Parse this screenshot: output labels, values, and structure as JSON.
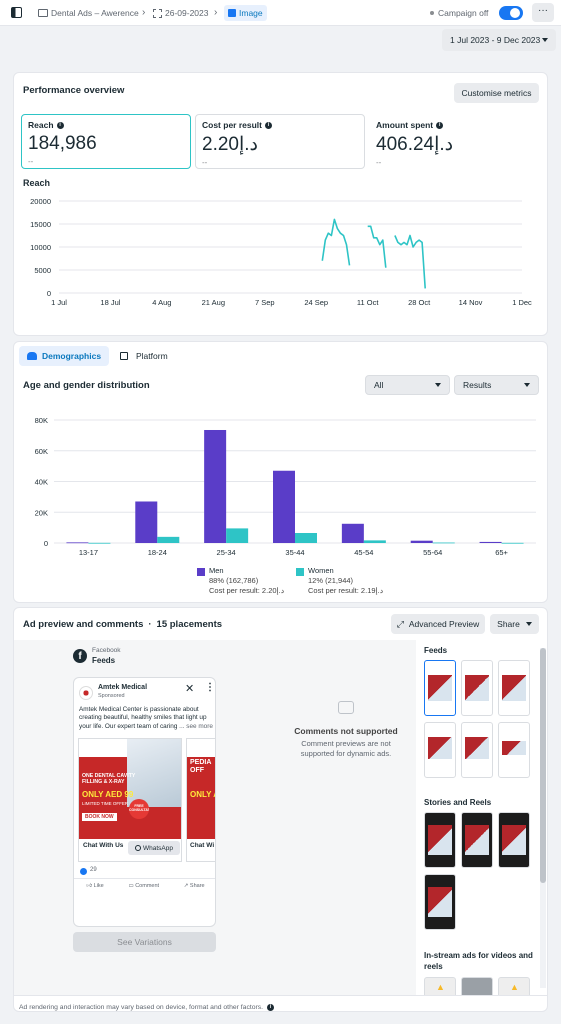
{
  "topbar": {
    "crumb1": "Dental Ads – Awerence",
    "crumb2": "26-09-2023",
    "crumb3": "Image",
    "campaign_status": "Campaign off"
  },
  "date_range": "1 Jul 2023 - 9 Dec 2023",
  "performance": {
    "title": "Performance overview",
    "customise_label": "Customise metrics",
    "metrics": [
      {
        "label": "Reach",
        "value": "184,986",
        "sub": "--"
      },
      {
        "label": "Cost per result",
        "value": "2.20د.إ",
        "sub": "--"
      },
      {
        "label": "Amount spent",
        "value": "406.24د.إ",
        "sub": "--"
      }
    ],
    "reach_chart_label": "Reach"
  },
  "chart_data": [
    {
      "type": "line",
      "title": "Reach",
      "x_ticks": [
        "1 Jul",
        "18 Jul",
        "4 Aug",
        "21 Aug",
        "7 Sep",
        "24 Sep",
        "11 Oct",
        "28 Oct",
        "14 Nov",
        "1 Dec"
      ],
      "y_ticks": [
        "0",
        "5000",
        "10000",
        "15000",
        "20000"
      ],
      "ylim": [
        0,
        20000
      ],
      "series": [
        {
          "x": [
            "2023-09-26",
            "2023-09-27",
            "2023-09-28",
            "2023-09-29",
            "2023-09-30",
            "2023-10-01",
            "2023-10-02",
            "2023-10-03",
            "2023-10-04",
            "2023-10-05"
          ],
          "values": [
            7000,
            11500,
            13000,
            12500,
            16000,
            14000,
            13000,
            12500,
            10500,
            6000
          ]
        },
        {
          "x": [
            "2023-10-11",
            "2023-10-12",
            "2023-10-13",
            "2023-10-14",
            "2023-10-15",
            "2023-10-16",
            "2023-10-17"
          ],
          "values": [
            14500,
            14500,
            12000,
            12000,
            10500,
            11500,
            5500
          ]
        },
        {
          "x": [
            "2023-10-20",
            "2023-10-21",
            "2023-10-22",
            "2023-10-23",
            "2023-10-24",
            "2023-10-25",
            "2023-10-26",
            "2023-10-27",
            "2023-10-28",
            "2023-10-29",
            "2023-10-30"
          ],
          "values": [
            12500,
            11000,
            10500,
            11000,
            10500,
            12500,
            10000,
            11000,
            11500,
            11000,
            1000
          ]
        }
      ]
    },
    {
      "type": "bar",
      "title": "Age and gender distribution",
      "categories": [
        "13-17",
        "18-24",
        "25-34",
        "35-44",
        "45-54",
        "55-64",
        "65+"
      ],
      "y_ticks": [
        "0",
        "20K",
        "40K",
        "60K",
        "80K"
      ],
      "ylim": [
        0,
        80000
      ],
      "series": [
        {
          "name": "Men",
          "color": "#5a3dc8",
          "values": [
            400,
            27000,
            73500,
            47000,
            12500,
            1500,
            700
          ]
        },
        {
          "name": "Women",
          "color": "#2ec4c6",
          "values": [
            100,
            4000,
            9500,
            6500,
            1700,
            300,
            100
          ]
        }
      ],
      "legend": [
        {
          "name": "Men",
          "pct": "88% (162,786)",
          "cost": "Cost per result: 2.20د.إ"
        },
        {
          "name": "Women",
          "pct": "12% (21,944)",
          "cost": "Cost per result: 2.19د.إ"
        }
      ]
    }
  ],
  "demographics": {
    "tab_demographics": "Demographics",
    "tab_platform": "Platform",
    "title": "Age and gender distribution",
    "filter_all": "All",
    "filter_results": "Results"
  },
  "ad_preview": {
    "title": "Ad preview and comments",
    "placements": "15 placements",
    "advanced_label": "Advanced Preview",
    "share_label": "Share",
    "platform_name": "Facebook",
    "placement_name": "Feeds",
    "page_name": "Amtek Medical",
    "sponsored": "Sponsored",
    "body_text": "Amtek Medical Center is passionate about creating beautiful, healthy smiles that light up your life. Our expert team of caring",
    "see_more": "... see more",
    "ad_headline_1": "ONE DENTAL CAVITY FILLING & X-RAY",
    "ad_price_1": "ONLY AED 99",
    "ad_limited": "LIMITED TIME OFFER",
    "ad_free": "FREE CONSULTATION",
    "ad_book": "BOOK NOW",
    "ad_headline_2": "PEDIA OFF",
    "ad_price_2": "ONLY A",
    "cta_1": "Chat With Us",
    "whatsapp": "WhatsApp",
    "cta_2": "Chat Wi",
    "likes": "29",
    "like": "Like",
    "comment": "Comment",
    "share": "Share",
    "see_variations": "See Variations",
    "comments_title": "Comments not supported",
    "comments_desc": "Comment previews are not supported for dynamic ads.",
    "section_feeds": "Feeds",
    "section_stories": "Stories and Reels",
    "section_instream": "In-stream ads for videos and reels",
    "footer": "Ad rendering and interaction may vary based on device, format and other factors."
  }
}
